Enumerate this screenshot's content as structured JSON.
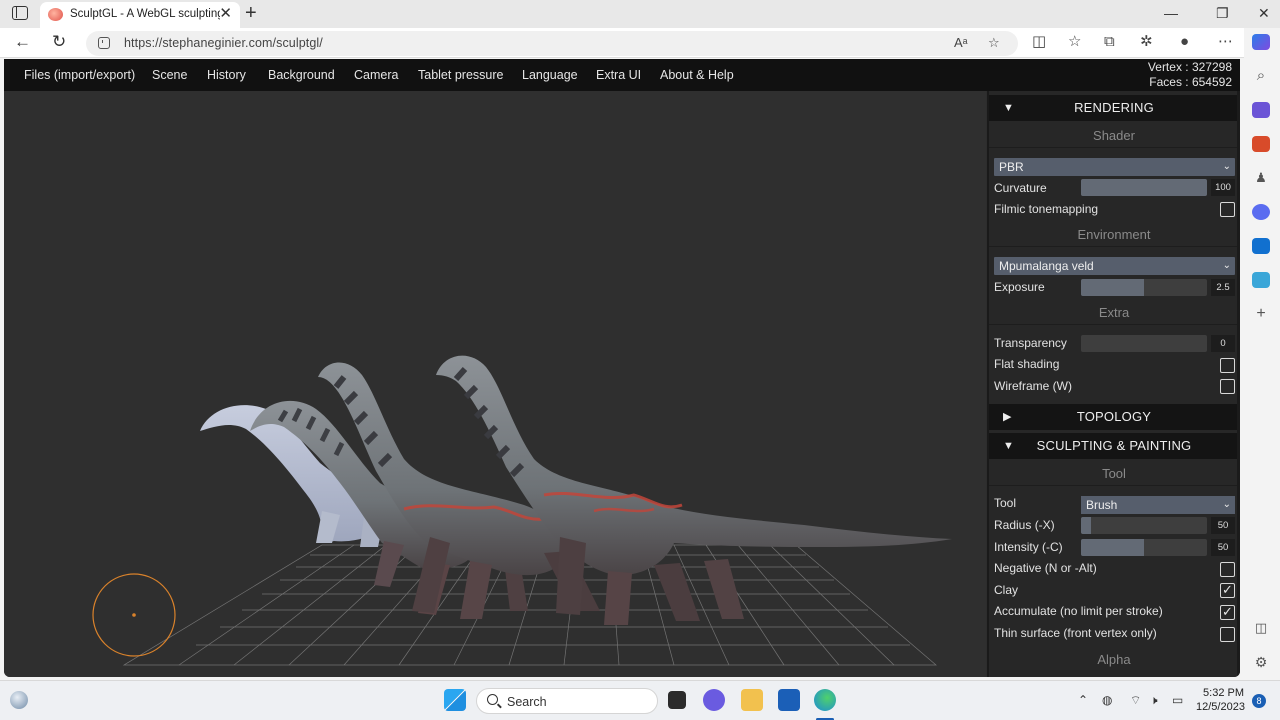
{
  "browser": {
    "tab_title": "SculptGL - A WebGL sculpting app",
    "tab_close": "✕",
    "new_tab": "+",
    "url": "https://stephaneginier.com/sculptgl/",
    "read_aloud": "Aᵃ",
    "win_min": "—",
    "win_max": "❐",
    "win_close": "✕"
  },
  "app": {
    "menu": [
      "Files (import/export)",
      "Scene",
      "History",
      "Background",
      "Camera",
      "Tablet pressure",
      "Language",
      "Extra UI",
      "About & Help"
    ],
    "stats": {
      "vertex": "Vertex : 327298",
      "faces": "Faces : 654592"
    }
  },
  "panel": {
    "rendering": {
      "title": "RENDERING",
      "shader_header": "Shader",
      "shader_value": "PBR",
      "curvature_label": "Curvature",
      "curvature_value": "100",
      "curvature_fill": 1.0,
      "filmic_label": "Filmic tonemapping",
      "filmic_checked": false,
      "environment_header": "Environment",
      "environment_value": "Mpumalanga veld",
      "exposure_label": "Exposure",
      "exposure_value": "2.5",
      "exposure_fill": 0.5,
      "extra_header": "Extra",
      "transparency_label": "Transparency",
      "transparency_value": "0",
      "transparency_fill": 0,
      "flat_label": "Flat shading",
      "flat_checked": false,
      "wireframe_label": "Wireframe (W)",
      "wireframe_checked": false
    },
    "topology": {
      "title": "TOPOLOGY"
    },
    "sculpting": {
      "title": "SCULPTING & PAINTING",
      "tool_header": "Tool",
      "tool_label": "Tool",
      "tool_value": "Brush",
      "radius_label": "Radius (-X)",
      "radius_value": "50",
      "radius_fill": 0.08,
      "intensity_label": "Intensity (-C)",
      "intensity_value": "50",
      "intensity_fill": 0.5,
      "negative_label": "Negative (N or -Alt)",
      "negative_checked": false,
      "clay_label": "Clay",
      "clay_checked": true,
      "accumulate_label": "Accumulate (no limit per stroke)",
      "accumulate_checked": true,
      "thin_label": "Thin surface (front vertex only)",
      "thin_checked": false,
      "alpha_header": "Alpha"
    },
    "arrow_open": "▼",
    "arrow_closed": "▶",
    "check_mark": "✓",
    "chevron": "⌄"
  },
  "taskbar": {
    "search": "Search",
    "time": "5:32 PM",
    "date": "12/5/2023",
    "notifications": "8"
  },
  "colors": {
    "viewport_bg": "#2f2f2f",
    "panel_bg": "#272727",
    "menubar_bg": "#111111",
    "brush_circle": "#d9822b"
  }
}
